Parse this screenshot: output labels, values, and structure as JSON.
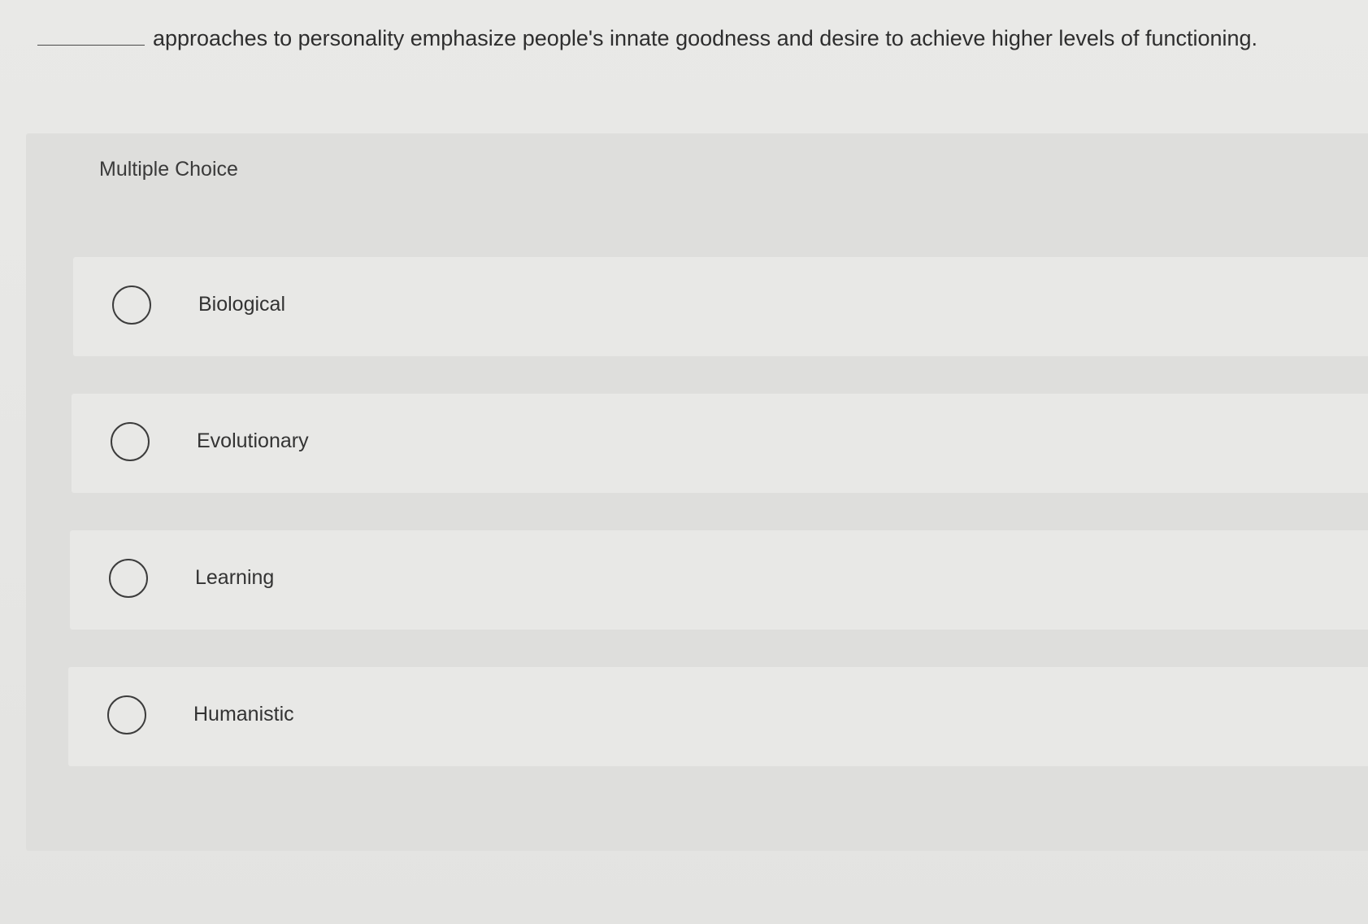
{
  "question": {
    "blank": "________",
    "text": "approaches to personality emphasize people's innate goodness and desire to achieve higher levels of functioning."
  },
  "multiple_choice": {
    "label": "Multiple Choice",
    "options": [
      {
        "label": "Biological"
      },
      {
        "label": "Evolutionary"
      },
      {
        "label": "Learning"
      },
      {
        "label": "Humanistic"
      }
    ]
  },
  "colors": {
    "background": "#e7e7e5",
    "panel": "#dededc",
    "option_row": "#e8e8e6",
    "text": "#333333"
  }
}
